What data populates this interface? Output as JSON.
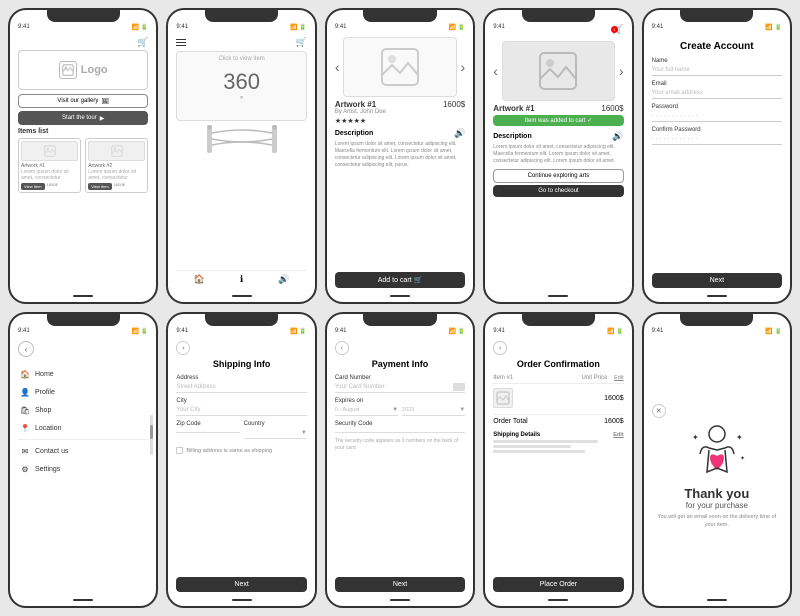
{
  "phones": {
    "row1": [
      {
        "id": "gallery",
        "status_left": "9:41",
        "status_right": "▪ ▪ ▪",
        "logo_text": "Logo",
        "visit_gallery": "Visit our gallery",
        "start_tour": "Start the tour",
        "items_label": "Items list",
        "items": [
          {
            "name": "Artwork #1",
            "desc": "Lorem ipsum dolor sit amet, consectetur adipiscing",
            "price": "1600$"
          },
          {
            "name": "Artwork #2",
            "desc": "Lorem ipsum dolor sit amet, consectetur adipiscing",
            "price": "1600$"
          }
        ]
      },
      {
        "id": "360view",
        "status_left": "9:41",
        "status_right": "▪ ▪ ▪",
        "click_hint": "Click to view item",
        "degree_label": "360°"
      },
      {
        "id": "artwork-detail",
        "status_left": "9:41",
        "status_right": "▪ ▪ ▪",
        "title": "Artwork #1",
        "price": "1600$",
        "artist": "By Artist, John Doe",
        "stars": "★★★★★",
        "description_label": "Description",
        "desc_text": "Lorem ipsum dolor sit amet, consectetur adipiscing elit. Maecella fermentum elit. Lorem ipsum dolor sit amet, consectetur adipiscing elit. Lorem ipsum dolor sit amet, consectetur adipiscing elit, purus.",
        "add_to_cart": "Add to cart 🛒"
      },
      {
        "id": "added-to-cart",
        "status_left": "9:41",
        "status_right": "▪ ▪ ▪",
        "title": "Artwork #1",
        "price": "1600$",
        "badge": "Item was added to cart ✓",
        "description_label": "Description",
        "desc_text": "Lorem ipsum dolor sit amet, consectetur adipiscing elit. Maecella fermentum elit. Lorem ipsum dolor sit amet, consectetur adipiscing elit. Lorem ipsum dolor sit amet.",
        "explore_btn": "Continue exploring arts",
        "checkout_btn": "Go to checkout"
      },
      {
        "id": "create-account",
        "status_left": "9:41",
        "status_right": "▪ ▪ ▪",
        "title": "Create Account",
        "name_label": "Name",
        "name_placeholder": "Your full name",
        "email_label": "Email",
        "email_placeholder": "Your email address",
        "password_label": "Password",
        "password_placeholder": "············",
        "confirm_label": "Confirm Password",
        "confirm_placeholder": "············",
        "next_btn": "Next"
      }
    ],
    "row2": [
      {
        "id": "sidebar-nav",
        "status_left": "9:41",
        "status_right": "▪ ▪ ▪",
        "nav_items": [
          {
            "icon": "🏠",
            "label": "Home"
          },
          {
            "icon": "👤",
            "label": "Profile"
          },
          {
            "icon": "🛍",
            "label": "Shop"
          },
          {
            "icon": "📍",
            "label": "Location"
          },
          {
            "icon": "✉",
            "label": "Contact us"
          },
          {
            "icon": "⚙",
            "label": "Settings"
          }
        ]
      },
      {
        "id": "shipping-info",
        "status_left": "9:41",
        "status_right": "▪ ▪ ▪",
        "title": "Shipping Info",
        "address_label": "Address",
        "address_placeholder": "Street Address",
        "city_label": "City",
        "city_placeholder": "Your City",
        "zip_label": "Zip Code",
        "country_label": "Country",
        "checkbox_label": "Billing address is same as shipping",
        "next_btn": "Next"
      },
      {
        "id": "payment-info",
        "status_left": "9:41",
        "status_right": "▪ ▪ ▪",
        "title": "Payment Info",
        "card_label": "Card Number",
        "card_placeholder": "Your Card Number",
        "expires_label": "Expires on",
        "month_placeholder": "0 - August",
        "year_placeholder": "2023",
        "security_label": "Security Code",
        "security_hint": "The security code appears as 3 numbers on the back of your card",
        "next_btn": "Next"
      },
      {
        "id": "order-confirmation",
        "status_left": "9:41",
        "status_right": "▪ ▪ ▪",
        "title": "Order Confirmation",
        "item_col": "Item #1",
        "unit_price_col": "Unit Price",
        "edit_link": "Edit",
        "item_price": "1600$",
        "total_label": "Order Total",
        "total_price": "1600$",
        "shipping_label": "Shipping Details",
        "shipping_edit": "Edit",
        "place_order_btn": "Place Order"
      },
      {
        "id": "thank-you",
        "status_left": "9:41",
        "status_right": "▪ ▪ ▪",
        "title": "Thank you",
        "subtitle": "for your purchase",
        "message": "You will get an email soon on the delivery time of your item."
      }
    ]
  }
}
